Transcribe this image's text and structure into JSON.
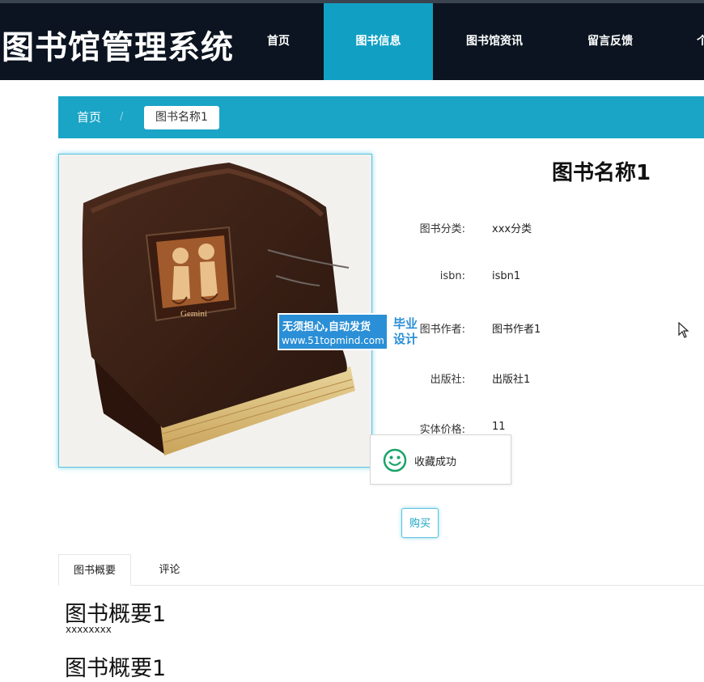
{
  "header": {
    "site_title": "图书馆管理系统",
    "nav": [
      {
        "label": "首页",
        "active": false
      },
      {
        "label": "图书信息",
        "active": true
      },
      {
        "label": "图书馆资讯",
        "active": false
      },
      {
        "label": "留言反馈",
        "active": false
      },
      {
        "label": "个",
        "active": false
      }
    ]
  },
  "breadcrumb": {
    "home": "首页",
    "separator": "/",
    "current": "图书名称1"
  },
  "book": {
    "title": "图书名称1",
    "image_icon": "book-cover-image",
    "fields": [
      {
        "label": "图书分类:",
        "value": "xxx分类"
      },
      {
        "label": "isbn:",
        "value": "isbn1"
      },
      {
        "label": "图书作者:",
        "value": "图书作者1"
      },
      {
        "label": "出版社:",
        "value": "出版社1"
      },
      {
        "label": "实体价格:",
        "value": "11"
      }
    ],
    "buy_label": "购买"
  },
  "watermark": {
    "line1": "无须担心,自动发货",
    "url": "www.51topmind.com",
    "badge": "毕业\n设计",
    "badge_line1": "毕业",
    "badge_line2": "设计"
  },
  "toast": {
    "icon": "smile-icon",
    "message": "收藏成功"
  },
  "tabs": [
    {
      "label": "图书概要",
      "active": true
    },
    {
      "label": "评论",
      "active": false
    }
  ],
  "summary": {
    "heading": "图书概要1",
    "text": "xxxxxxxx",
    "heading2": "图书概要1"
  },
  "colors": {
    "nav_bg": "#0b1420",
    "accent": "#11a0c4",
    "toast_icon": "#1aa46a"
  }
}
